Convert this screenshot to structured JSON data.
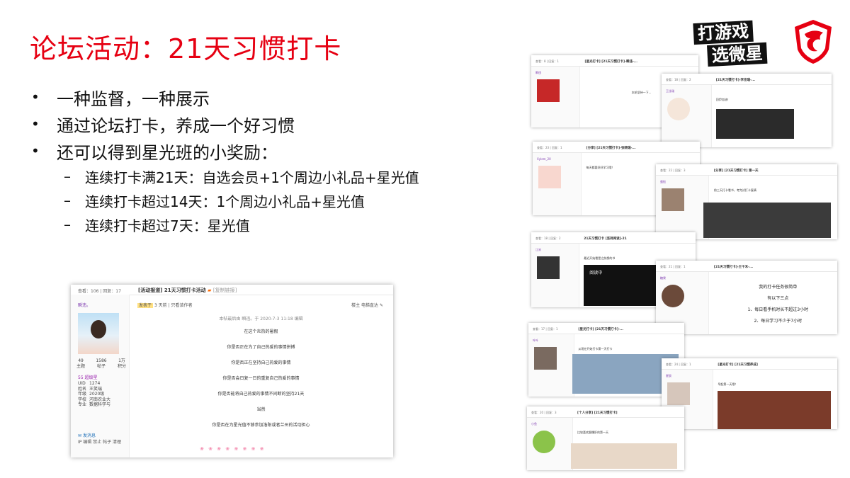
{
  "slide": {
    "title": "论坛活动：21天习惯打卡",
    "bullets": [
      "一种监督，一种展示",
      "通过论坛打卡，养成一个好习惯",
      "还可以得到星光班的小奖励："
    ],
    "sub_bullets": [
      "连续打卡满21天：自选会员+1个周边小礼品+星光值",
      "连续打卡超过14天：1个周边小礼品+星光值",
      "连续打卡超过7天：星光值"
    ]
  },
  "logos": {
    "slogan_line1": "打游戏",
    "slogan_line2": "选微星",
    "brand_red": "#e60012"
  },
  "post": {
    "stats": "查看：106  |  回复：17",
    "title": "[活动报道] 21天习惯打卡活动",
    "tag": "[复制链接]",
    "username": "瞬违。",
    "counts": [
      {
        "num": "49",
        "label": "主题"
      },
      {
        "num": "1586",
        "label": "帖子"
      },
      {
        "num": "1万",
        "label": "积分"
      }
    ],
    "group": "55 超级星",
    "info": [
      {
        "k": "UID",
        "v": "1274"
      },
      {
        "k": "姓名",
        "v": "王笑瑞"
      },
      {
        "k": "年级",
        "v": "2020级"
      },
      {
        "k": "学校",
        "v": "河南农业大"
      },
      {
        "k": "专业",
        "v": "数据科学与"
      }
    ],
    "send_message": "发消息",
    "ops": "IP  编辑  禁止  帖子  清理",
    "meta_badge": "发表于",
    "meta": "3 天前  |  只看该作者",
    "right_meta": "楼主    电梯直达",
    "edit_note": "本帖最后由 瞬违。于 2020-7-3 11:18 编辑",
    "lines": [
      "在这个炎热的暑假",
      "你是否正在为了自己热爱的事情拼搏",
      "你是否正在坚持自己热爱的事情",
      "你是否会日复一日的重复自己热爱的事情",
      "你是否能将自己热爱的事情不间断的坚持21天",
      "当然",
      "你是否在为星光值不够参加洛阳或者兰州的活动担心"
    ]
  },
  "cards": [
    {
      "stat": "查看：8 | 回复：1",
      "title": "[星光打卡] [21天习惯打卡]-瞬违-...",
      "user": "瞬违",
      "text": "本轮坚持一下..."
    },
    {
      "stat": "查看：18 | 回复：2",
      "title": "[21天习惯打卡]-李佳瑞-...",
      "user": "王佳瑞",
      "text": "回伊加油！"
    },
    {
      "stat": "查看：23 | 回复：1",
      "title": "[分享] [21天习惯打卡]-张晓瑞-...",
      "user": "Xylem_20",
      "text": "每天都要好好学习哦！"
    },
    {
      "stat": "查看：22 | 回复：3",
      "title": "[分享] [21天习惯打卡] 第一天",
      "user": "蛋挞",
      "text": "前三天打卡看书，考完试打卡复精"
    },
    {
      "stat": "查看：18 | 回复：2",
      "title": "21天习惯打卡 [坚持阅读]-21",
      "user": "江米",
      "text": "最近开始看是之前想的书"
    },
    {
      "stat": "查看：21 | 回复：1",
      "title": "[21天习惯打卡]-王千禾-...",
      "user": "糖果",
      "text": "我的打卡任务很简单"
    },
    {
      "stat": "查看：17 | 回复：1",
      "title": "[星光打卡] [21天习惯打卡]-...",
      "user": "叶叶",
      "text": "从现在开始打卡第一天打卡"
    },
    {
      "stat": "查看：24 | 回复：1",
      "title": "[星光打卡] [21天习惯养成]",
      "user": "星辰",
      "text": "早起第一天哦！"
    },
    {
      "stat": "查看：20 | 回复：3",
      "title": "[个人分享] [21天习惯打卡]",
      "user": "小鱼",
      "text": "比较喜欢跟爆肝的第一天"
    }
  ],
  "card_big_text": [
    "我的打卡任务很简单",
    "有以下三点",
    "1、每日看手机时长不超过3小时",
    "2、每日学习不少于7小时"
  ],
  "card_screen_text": "阅读中"
}
